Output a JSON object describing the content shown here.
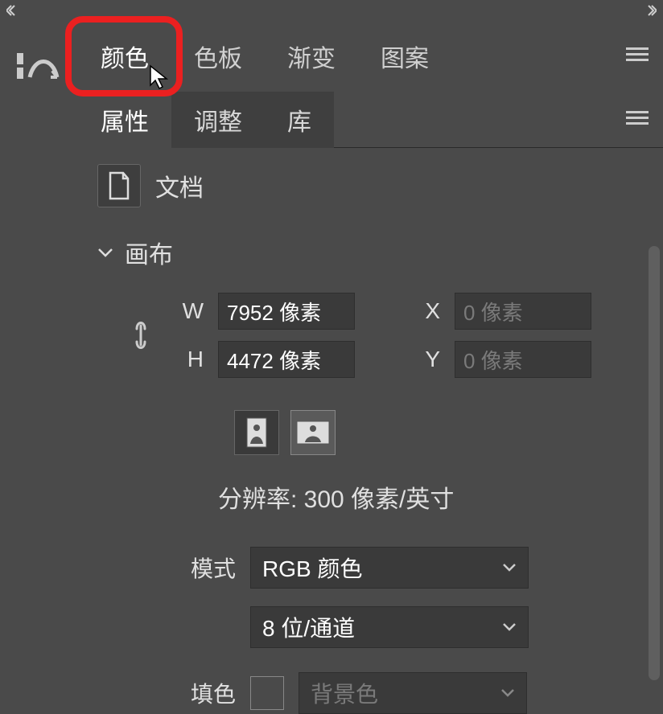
{
  "topTabs": {
    "items": [
      "颜色",
      "色板",
      "渐变",
      "图案"
    ],
    "activeIndex": 0
  },
  "subTabs": {
    "items": [
      "属性",
      "调整",
      "库"
    ],
    "activeIndex": 0
  },
  "docHeader": {
    "label": "文档"
  },
  "canvas": {
    "section_label": "画布",
    "wLabel": "W",
    "wValue": "7952 像素",
    "hLabel": "H",
    "hValue": "4472 像素",
    "xLabel": "X",
    "xPlaceholder": "0 像素",
    "yLabel": "Y",
    "yPlaceholder": "0 像素",
    "resolutionText": "分辨率: 300 像素/英寸",
    "modeLabel": "模式",
    "modeValue": "RGB 颜色",
    "bitDepth": "8 位/通道",
    "fillLabel": "填色",
    "fillValue": "背景色"
  }
}
